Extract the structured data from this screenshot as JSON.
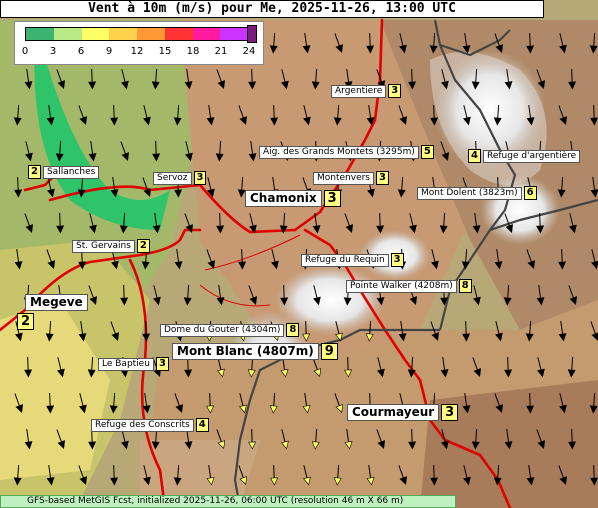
{
  "title": "Vent à 10m (m/s) pour Me, 2025-11-26, 13:00 UTC",
  "footer": "GFS-based MetGIS Fcst, initialized 2025-11-26, 06:00 UTC  (resolution 46 m X 66 m)",
  "legend": {
    "ticks": [
      "0",
      "3",
      "6",
      "9",
      "12",
      "15",
      "18",
      "21",
      "24"
    ],
    "colors": [
      "#3cb371",
      "#b8e986",
      "#ffff66",
      "#ffd24d",
      "#ff9933",
      "#ff3333",
      "#ff1aa0",
      "#cc33ff",
      "#9900cc"
    ]
  },
  "places": [
    {
      "name": "Argentiere",
      "value": "3"
    },
    {
      "name": "Aig. des Grands Montets (3295m)",
      "value": "5"
    },
    {
      "name": "",
      "value": "4"
    },
    {
      "name": "Refuge d'argentière",
      "value": ""
    },
    {
      "name": "Sallanches",
      "value": "2"
    },
    {
      "name": "Servoz",
      "value": "3"
    },
    {
      "name": "Montenvers",
      "value": "3"
    },
    {
      "name": "Mont Dolent (3823m)",
      "value": "6"
    },
    {
      "name": "Chamonix",
      "value": "3"
    },
    {
      "name": "St. Gervains",
      "value": "2"
    },
    {
      "name": "Refuge du Requin",
      "value": "3"
    },
    {
      "name": "Pointe Walker (4208m)",
      "value": "8"
    },
    {
      "name": "Megeve",
      "value": "2"
    },
    {
      "name": "Dome du Gouter (4304m)",
      "value": "8"
    },
    {
      "name": "Mont Blanc (4807m)",
      "value": "9"
    },
    {
      "name": "Le Baptieu",
      "value": "3"
    },
    {
      "name": "Courmayeur",
      "value": "3"
    },
    {
      "name": "Refuge des Conscrits",
      "value": "4"
    }
  ]
}
